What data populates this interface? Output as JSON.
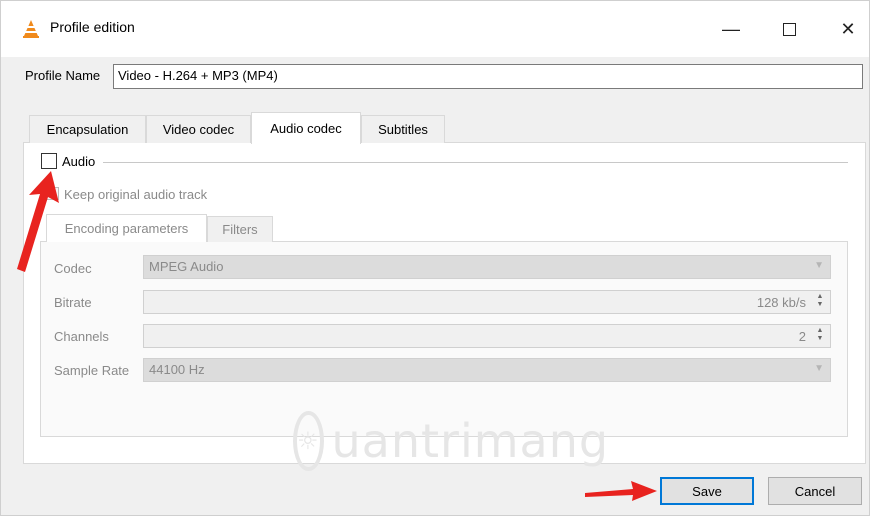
{
  "window": {
    "title": "Profile edition",
    "minimize": "—",
    "close": "✕"
  },
  "profile": {
    "label": "Profile Name",
    "value": "Video - H.264 + MP3 (MP4)"
  },
  "tabs": [
    {
      "label": "Encapsulation",
      "active": false
    },
    {
      "label": "Video codec",
      "active": false
    },
    {
      "label": "Audio codec",
      "active": true
    },
    {
      "label": "Subtitles",
      "active": false
    }
  ],
  "audio": {
    "checkbox_label": "Audio",
    "checked": false,
    "keep_original_label": "Keep original audio track"
  },
  "inner_tabs": [
    {
      "label": "Encoding parameters"
    },
    {
      "label": "Filters"
    }
  ],
  "fields": {
    "codec": {
      "label": "Codec",
      "value": "MPEG Audio"
    },
    "bitrate": {
      "label": "Bitrate",
      "value": "128 kb/s"
    },
    "channels": {
      "label": "Channels",
      "value": "2"
    },
    "sample_rate": {
      "label": "Sample Rate",
      "value": "44100 Hz"
    }
  },
  "watermark": "uantrimang",
  "buttons": {
    "save": "Save",
    "cancel": "Cancel"
  },
  "colors": {
    "arrow": "#e8231f",
    "focus_border": "#0078d7"
  }
}
